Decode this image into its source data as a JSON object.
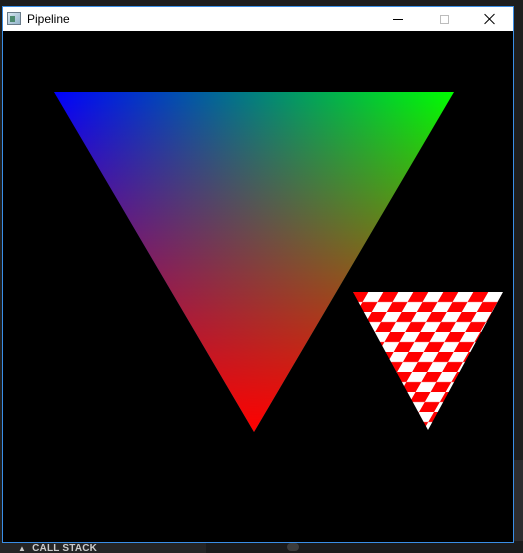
{
  "window": {
    "title": "Pipeline",
    "icon": "app-window-icon",
    "controls": {
      "minimize": "minimize-icon",
      "maximize": "maximize-icon",
      "close": "close-icon"
    }
  },
  "scene": {
    "background": "#000000",
    "gradient_triangle": {
      "vertex_colors": [
        "#0000ff",
        "#00ff00",
        "#ff0000"
      ]
    },
    "checker_triangle": {
      "colors": [
        "#ff0000",
        "#ffffff"
      ]
    }
  },
  "background_ide": {
    "panel_label": "CALL STACK",
    "panel_icon": "collapse-triangle-icon"
  }
}
